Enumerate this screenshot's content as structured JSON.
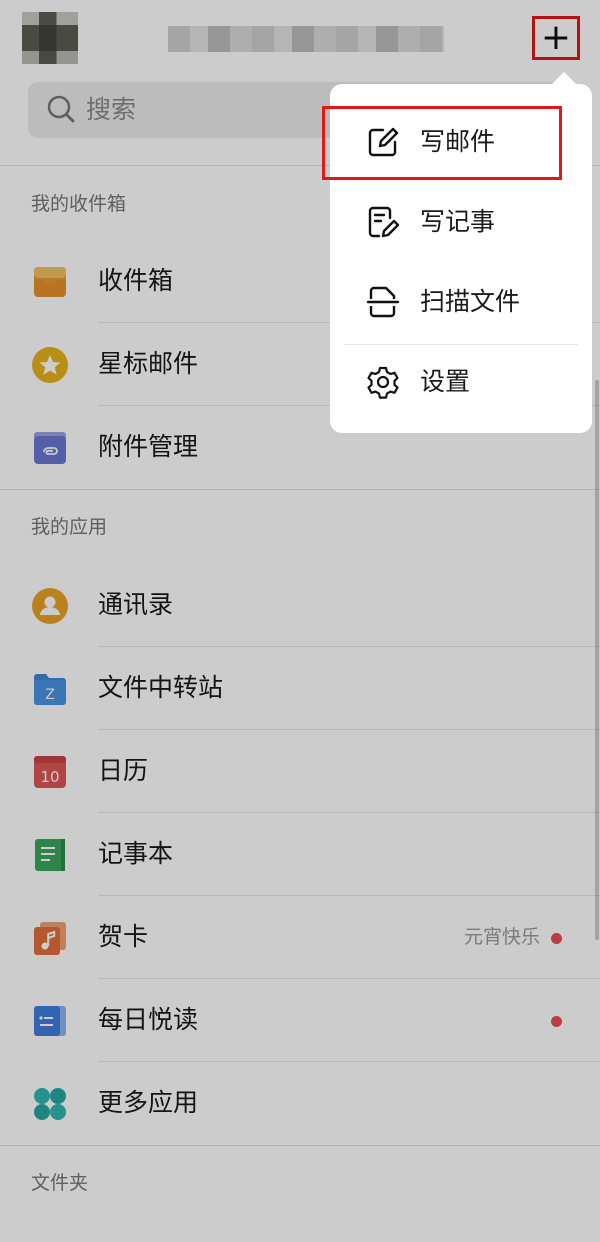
{
  "header": {
    "add_label": "+"
  },
  "search": {
    "placeholder": "搜索"
  },
  "sections": {
    "inbox_title": "我的收件箱",
    "apps_title": "我的应用",
    "folders_title": "文件夹"
  },
  "inbox_items": [
    {
      "label": "收件箱",
      "icon": "inbox-icon"
    },
    {
      "label": "星标邮件",
      "icon": "star-icon"
    },
    {
      "label": "附件管理",
      "icon": "attachment-icon"
    }
  ],
  "app_items": [
    {
      "label": "通讯录",
      "icon": "contacts-icon"
    },
    {
      "label": "文件中转站",
      "icon": "file-transfer-icon"
    },
    {
      "label": "日历",
      "icon": "calendar-icon",
      "icon_text": "10"
    },
    {
      "label": "记事本",
      "icon": "notebook-icon"
    },
    {
      "label": "贺卡",
      "icon": "greeting-card-icon",
      "badge": "元宵快乐"
    },
    {
      "label": "每日悦读",
      "icon": "daily-reading-icon"
    },
    {
      "label": "更多应用",
      "icon": "more-apps-icon"
    }
  ],
  "menu": {
    "compose": "写邮件",
    "note": "写记事",
    "scan": "扫描文件",
    "settings": "设置"
  },
  "colors": {
    "highlight": "#e01818",
    "badge_dot": "#e94c55",
    "inbox_orange": "#e89a2c",
    "star_yellow": "#e8b21c",
    "attachment_blue": "#6a76d4",
    "contacts_orange": "#e8a326",
    "folder_blue": "#3d86d8",
    "calendar_red": "#e05656",
    "notebook_green": "#3aa65c",
    "card_orange": "#e2703a",
    "reading_blue": "#3f7fde",
    "more_teal": "#2fb7b2"
  }
}
